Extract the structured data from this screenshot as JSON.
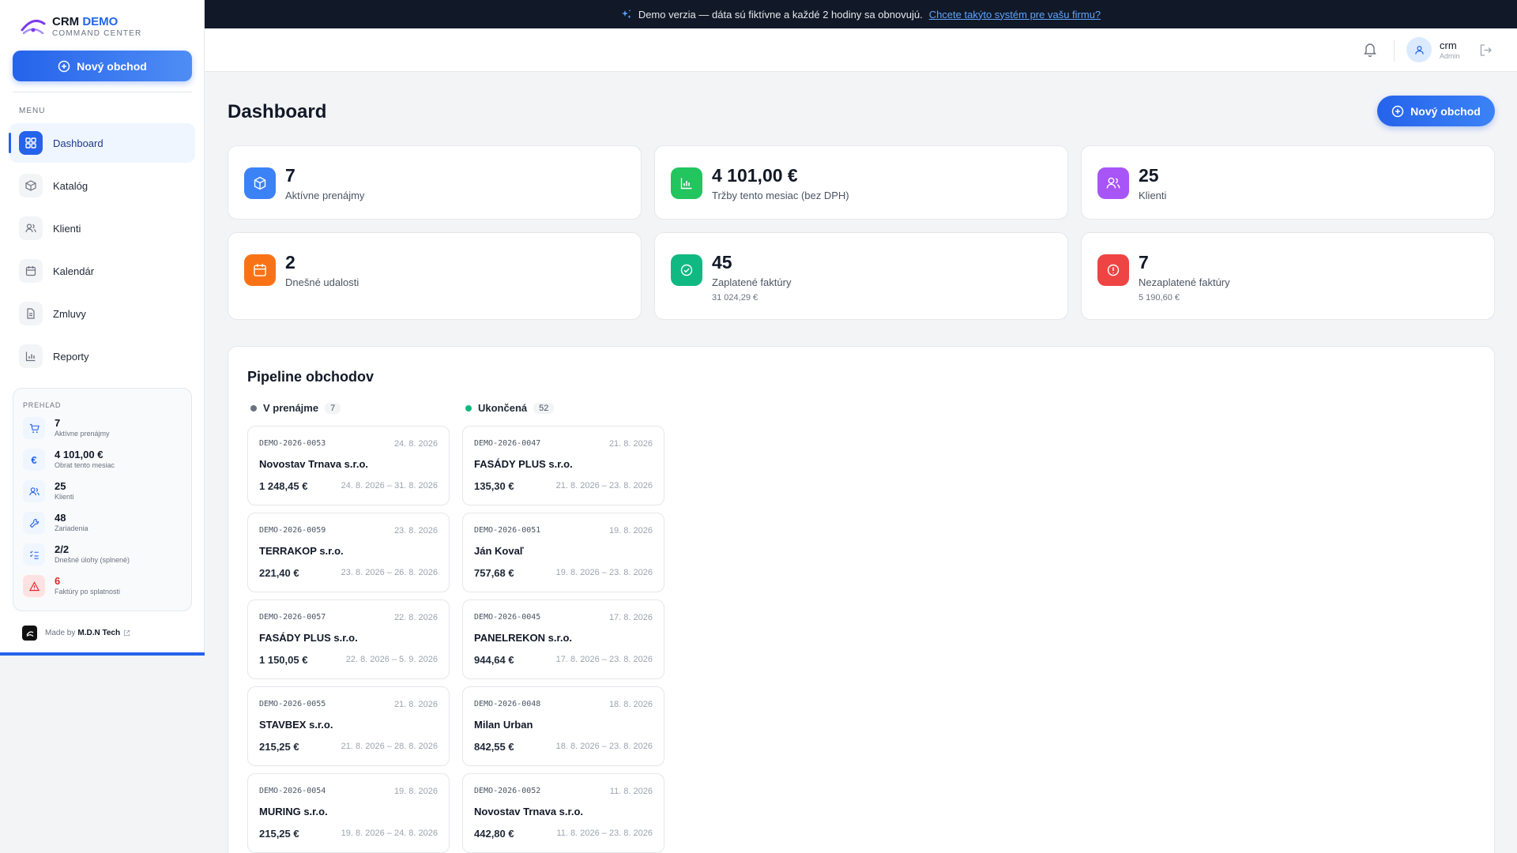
{
  "brand": {
    "name": "CRM",
    "accent": "DEMO",
    "subtitle": "COMMAND CENTER"
  },
  "sidebar": {
    "new_button": "Nový obchod",
    "menu_label": "MENU",
    "items": [
      {
        "label": "Dashboard",
        "icon": "grid-icon",
        "active": true
      },
      {
        "label": "Katalóg",
        "icon": "box-icon",
        "active": false
      },
      {
        "label": "Klienti",
        "icon": "users-icon",
        "active": false
      },
      {
        "label": "Kalendár",
        "icon": "calendar-icon",
        "active": false
      },
      {
        "label": "Zmluvy",
        "icon": "document-icon",
        "active": false
      },
      {
        "label": "Reporty",
        "icon": "bar-chart-icon",
        "active": false
      }
    ],
    "overview": {
      "label": "PREHĽAD",
      "rows": [
        {
          "value": "7",
          "label": "Aktívne prenájmy",
          "icon": "cart-icon"
        },
        {
          "value": "4 101,00 €",
          "label": "Obrat tento mesiac",
          "icon": "euro-icon"
        },
        {
          "value": "25",
          "label": "Klienti",
          "icon": "users-icon"
        },
        {
          "value": "48",
          "label": "Zariadenia",
          "icon": "wrench-icon"
        },
        {
          "value": "2/2",
          "label": "Dnešné úlohy (splnené)",
          "icon": "checklist-icon"
        },
        {
          "value": "6",
          "label": "Faktúry po splatnosti",
          "icon": "warning-icon"
        }
      ]
    },
    "made_by_prefix": "Made by",
    "made_by_name": "M.D.N Tech"
  },
  "banner": {
    "text": "Demo verzia — dáta sú fiktívne a každé 2 hodiny sa obnovujú.",
    "link": "Chcete takýto systém pre vašu firmu?"
  },
  "header": {
    "user_name": "crm",
    "user_role": "Admin"
  },
  "page": {
    "title": "Dashboard",
    "new_button": "Nový obchod"
  },
  "stats": [
    {
      "value": "7",
      "label": "Aktívne prenájmy",
      "sub": "",
      "color": "#3b82f6",
      "icon": "package-icon"
    },
    {
      "value": "4 101,00 €",
      "label": "Tržby tento mesiac (bez DPH)",
      "sub": "",
      "color": "#22c55e",
      "icon": "bar-chart-icon"
    },
    {
      "value": "25",
      "label": "Klienti",
      "sub": "",
      "color": "#a855f7",
      "icon": "users-icon"
    },
    {
      "value": "2",
      "label": "Dnešné udalosti",
      "sub": "",
      "color": "#f97316",
      "icon": "calendar-icon"
    },
    {
      "value": "45",
      "label": "Zaplatené faktúry",
      "sub": "31 024,29 €",
      "color": "#10b981",
      "icon": "check-circle-icon"
    },
    {
      "value": "7",
      "label": "Nezaplatené faktúry",
      "sub": "5 190,60 €",
      "color": "#ef4444",
      "icon": "alert-circle-icon"
    }
  ],
  "pipeline": {
    "title": "Pipeline obchodov",
    "columns": [
      {
        "name": "V prenájme",
        "count": "7",
        "dot_color": "#6b7280",
        "deals": [
          {
            "id": "DEMO-2026-0053",
            "date": "24. 8. 2026",
            "client": "Novostav Trnava s.r.o.",
            "amount": "1 248,45 €",
            "range": "24. 8. 2026 – 31. 8. 2026"
          },
          {
            "id": "DEMO-2026-0059",
            "date": "23. 8. 2026",
            "client": "TERRAKOP s.r.o.",
            "amount": "221,40 €",
            "range": "23. 8. 2026 – 26. 8. 2026"
          },
          {
            "id": "DEMO-2026-0057",
            "date": "22. 8. 2026",
            "client": "FASÁDY PLUS s.r.o.",
            "amount": "1 150,05 €",
            "range": "22. 8. 2026 – 5. 9. 2026"
          },
          {
            "id": "DEMO-2026-0055",
            "date": "21. 8. 2026",
            "client": "STAVBEX s.r.o.",
            "amount": "215,25 €",
            "range": "21. 8. 2026 – 28. 8. 2026"
          },
          {
            "id": "DEMO-2026-0054",
            "date": "19. 8. 2026",
            "client": "MURING s.r.o.",
            "amount": "215,25 €",
            "range": "19. 8. 2026 – 24. 8. 2026"
          }
        ]
      },
      {
        "name": "Ukončená",
        "count": "52",
        "dot_color": "#10b981",
        "deals": [
          {
            "id": "DEMO-2026-0047",
            "date": "21. 8. 2026",
            "client": "FASÁDY PLUS s.r.o.",
            "amount": "135,30 €",
            "range": "21. 8. 2026 – 23. 8. 2026"
          },
          {
            "id": "DEMO-2026-0051",
            "date": "19. 8. 2026",
            "client": "Ján Kovaľ",
            "amount": "757,68 €",
            "range": "19. 8. 2026 – 23. 8. 2026"
          },
          {
            "id": "DEMO-2026-0045",
            "date": "17. 8. 2026",
            "client": "PANELREKON s.r.o.",
            "amount": "944,64 €",
            "range": "17. 8. 2026 – 23. 8. 2026"
          },
          {
            "id": "DEMO-2026-0048",
            "date": "18. 8. 2026",
            "client": "Milan Urban",
            "amount": "842,55 €",
            "range": "18. 8. 2026 – 23. 8. 2026"
          },
          {
            "id": "DEMO-2026-0052",
            "date": "11. 8. 2026",
            "client": "Novostav Trnava s.r.o.",
            "amount": "442,80 €",
            "range": "11. 8. 2026 – 23. 8. 2026"
          }
        ]
      }
    ]
  },
  "colors": {
    "primary": "#2563eb",
    "banner_bg": "#111827",
    "danger": "#dc2626"
  }
}
